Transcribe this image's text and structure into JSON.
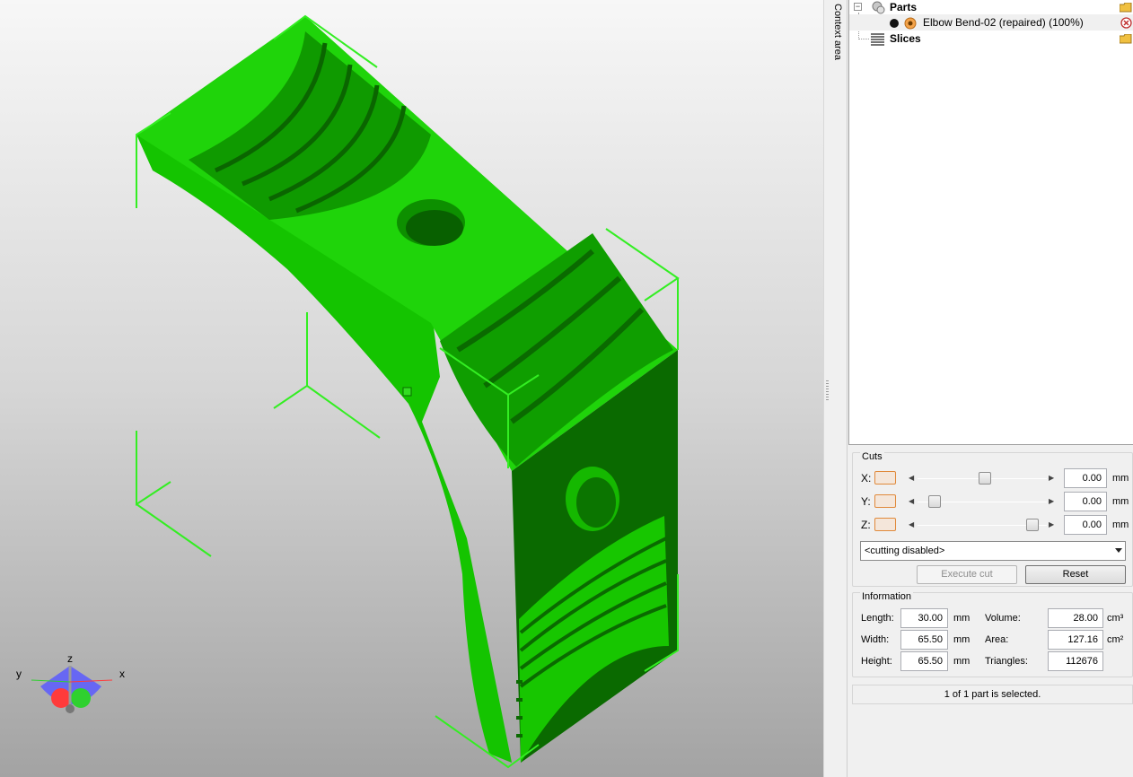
{
  "sidebar_tab": {
    "label": "Context area"
  },
  "tree": {
    "parts_label": "Parts",
    "part_item_label": "Elbow Bend-02 (repaired) (100%)",
    "slices_label": "Slices",
    "expander_symbol": "⊟"
  },
  "cuts": {
    "title": "Cuts",
    "x": {
      "label": "X:",
      "value": "0.00",
      "unit": "mm",
      "slider_position": 0.52
    },
    "y": {
      "label": "Y:",
      "value": "0.00",
      "unit": "mm",
      "slider_position": 0.09
    },
    "z": {
      "label": "Z:",
      "value": "0.00",
      "unit": "mm",
      "slider_position": 0.93
    },
    "mode_selected": "<cutting disabled>",
    "execute_label": "Execute cut",
    "reset_label": "Reset"
  },
  "info": {
    "title": "Information",
    "length_label": "Length:",
    "length_value": "30.00",
    "length_unit": "mm",
    "width_label": "Width:",
    "width_value": "65.50",
    "width_unit": "mm",
    "height_label": "Height:",
    "height_value": "65.50",
    "height_unit": "mm",
    "volume_label": "Volume:",
    "volume_value": "28.00",
    "volume_unit": "cm³",
    "area_label": "Area:",
    "area_value": "127.16",
    "area_unit": "cm²",
    "triangles_label": "Triangles:",
    "triangles_value": "112676"
  },
  "status": {
    "text": "1 of 1 part is selected."
  },
  "axes_gizmo": {
    "x": "x",
    "y": "y",
    "z": "z"
  },
  "colors": {
    "model_light": "#22dd0e",
    "model_mid": "#12b800",
    "model_dark": "#0a6f00",
    "bbox_line": "#33ee22",
    "accent_orange": "#e0893a"
  }
}
